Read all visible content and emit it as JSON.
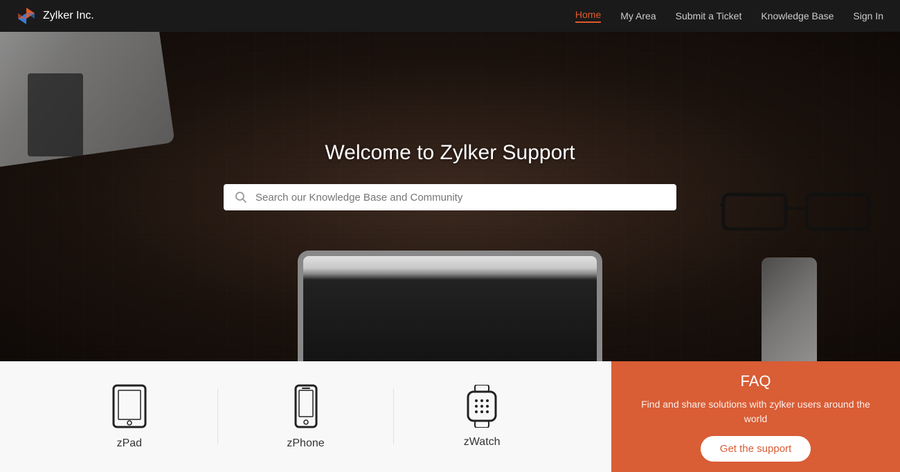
{
  "navbar": {
    "brand": "Zylker Inc.",
    "links": [
      {
        "id": "home",
        "label": "Home",
        "active": true
      },
      {
        "id": "my-area",
        "label": "My Area",
        "active": false
      },
      {
        "id": "submit-ticket",
        "label": "Submit a Ticket",
        "active": false
      },
      {
        "id": "knowledge-base",
        "label": "Knowledge Base",
        "active": false
      },
      {
        "id": "sign-in",
        "label": "Sign In",
        "active": false
      }
    ]
  },
  "hero": {
    "title": "Welcome to Zylker Support",
    "search_placeholder": "Search our Knowledge Base and Community"
  },
  "products": [
    {
      "id": "zpad",
      "label": "zPad"
    },
    {
      "id": "zphone",
      "label": "zPhone"
    },
    {
      "id": "zwatch",
      "label": "zWatch"
    }
  ],
  "faq": {
    "title": "FAQ",
    "description": "Find and share solutions with zylker users around the world",
    "button_label": "Get the support"
  }
}
